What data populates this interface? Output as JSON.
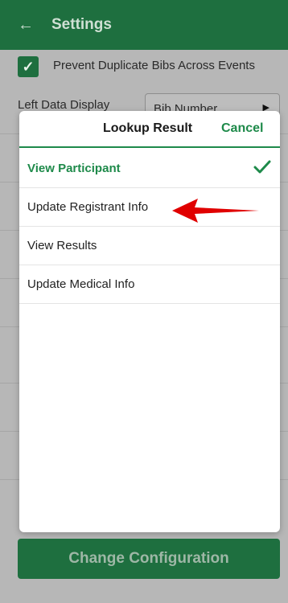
{
  "header": {
    "title": "Settings",
    "back_icon": "arrow-left-icon"
  },
  "settings": {
    "prevent_duplicates_label": "Prevent Duplicate Bibs Across Events",
    "prevent_duplicates_checked": true,
    "left_data_display_label": "Left Data Display",
    "left_data_display_value": "Bib Number"
  },
  "modal": {
    "title": "Lookup Result",
    "cancel_label": "Cancel",
    "options": [
      {
        "label": "View Participant",
        "selected": true
      },
      {
        "label": "Update Registrant Info",
        "selected": false
      },
      {
        "label": "View Results",
        "selected": false
      },
      {
        "label": "Update Medical Info",
        "selected": false
      }
    ]
  },
  "footer": {
    "change_configuration_label": "Change Configuration"
  },
  "colors": {
    "brand_green": "#1e6f3f",
    "accent_green": "#1e8a4a",
    "annotation_red": "#e00000"
  }
}
